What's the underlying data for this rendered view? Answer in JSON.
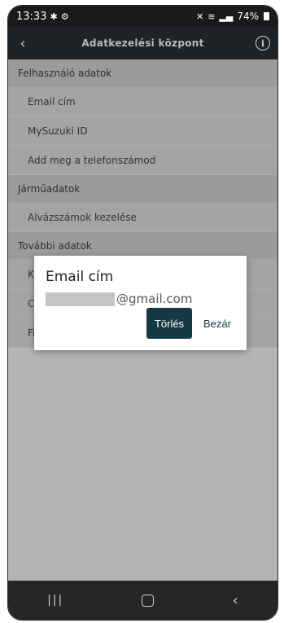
{
  "status": {
    "time": "13:33",
    "battery": "74%"
  },
  "app_bar": {
    "title": "Adatkezelési központ"
  },
  "sections": [
    {
      "header": "Felhasználó adatok",
      "items": [
        "Email cím",
        "MySuzuki ID",
        "Add meg a telefonszámod"
      ]
    },
    {
      "header": "Járműadatok",
      "items": [
        "Alvázszámok kezelése"
      ]
    },
    {
      "header": "További adatok",
      "items": [
        "Kö",
        "CA",
        "Fi"
      ]
    }
  ],
  "dialog": {
    "title": "Email cím",
    "email_suffix": "@gmail.com",
    "delete_label": "Törlés",
    "close_label": "Bezár"
  }
}
